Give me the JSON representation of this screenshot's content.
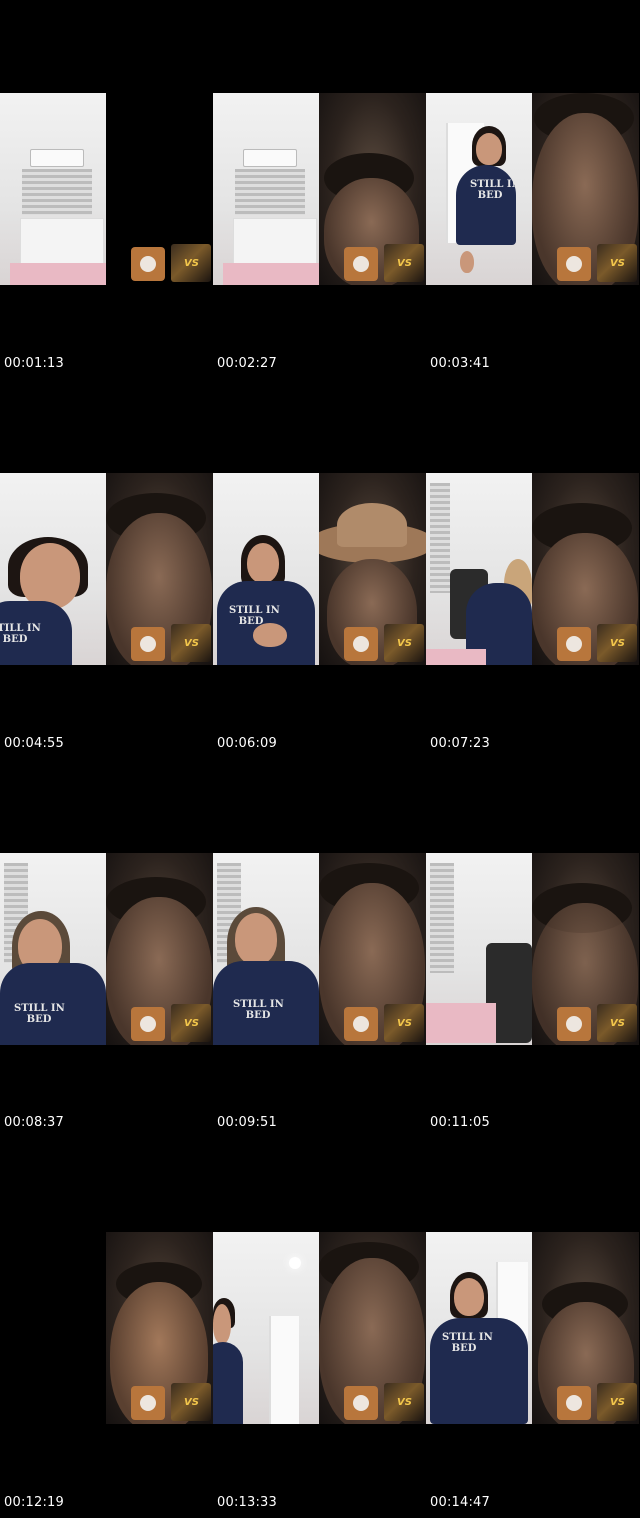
{
  "timestamps": [
    "00:01:13",
    "00:02:27",
    "00:03:41",
    "00:04:55",
    "00:06:09",
    "00:07:23",
    "00:08:37",
    "00:09:51",
    "00:11:05",
    "00:12:19",
    "00:13:33",
    "00:14:47"
  ],
  "sweater_text": "STILL IN\nBED",
  "overlay_vs_text": "VS",
  "colors": {
    "background": "#000000",
    "timestamp": "#ffffff",
    "sweater": "#1f2a4f",
    "overlay_avatar": "#b8763c"
  }
}
